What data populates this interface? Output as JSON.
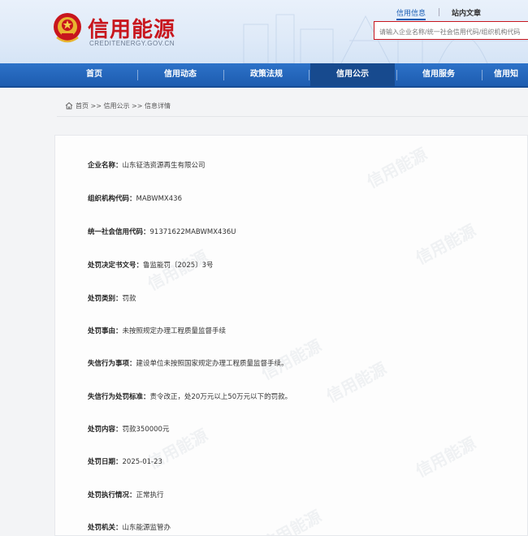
{
  "header": {
    "site_title": "信用能源",
    "site_domain": "CREDITENERGY.GOV.CN",
    "search_tabs": [
      "信用信息",
      "站内文章"
    ],
    "search_placeholder": "请输入企业名称/统一社会信用代码/组织机构代码"
  },
  "nav": {
    "items": [
      "首页",
      "信用动态",
      "政策法规",
      "信用公示",
      "信用服务",
      "信用知"
    ],
    "active_index": 3
  },
  "breadcrumb": {
    "items": [
      "首页",
      "信用公示",
      "信息详情"
    ],
    "separator": ">>"
  },
  "watermark_text": "信用能源",
  "details": [
    {
      "label": "企业名称：",
      "value": "山东钲浩资源再生有限公司"
    },
    {
      "label": "组织机构代码：",
      "value": "MABWMX436"
    },
    {
      "label": "统一社会信用代码：",
      "value": "91371622MABWMX436U"
    },
    {
      "label": "处罚决定书文号：",
      "value": "鲁监能罚〔2025〕3号"
    },
    {
      "label": "处罚类别：",
      "value": "罚款"
    },
    {
      "label": "处罚事由：",
      "value": "未按照规定办理工程质量监督手续"
    },
    {
      "label": "失信行为事项：",
      "value": "建设单位未按照国家规定办理工程质量监督手续。"
    },
    {
      "label": "失信行为处罚标准：",
      "value": "责令改正，处20万元以上50万元以下的罚款。"
    },
    {
      "label": "处罚内容：",
      "value": "罚款350000元"
    },
    {
      "label": "处罚日期：",
      "value": "2025-01-23"
    },
    {
      "label": "处罚执行情况：",
      "value": "正常执行"
    },
    {
      "label": "处罚机关：",
      "value": "山东能源监管办"
    }
  ],
  "colors": {
    "brand_red": "#c8161d",
    "nav_blue": "#1d5cb0",
    "nav_active": "#174a8e",
    "tab_blue": "#1c5fb5"
  }
}
